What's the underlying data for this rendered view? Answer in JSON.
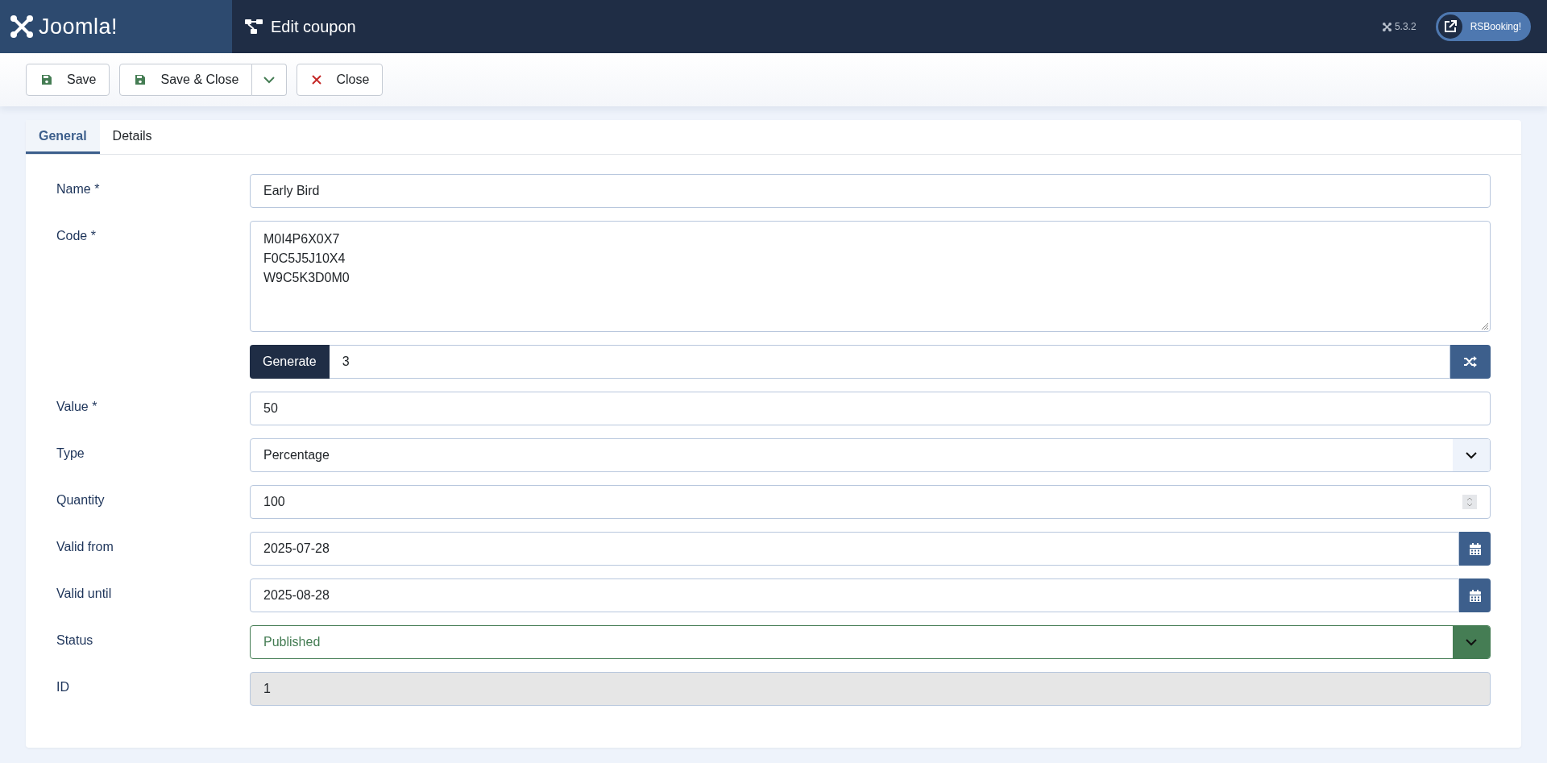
{
  "header": {
    "logo": "Joomla!",
    "title": "Edit coupon",
    "version": "5.3.2",
    "site_link": "RSBooking!"
  },
  "toolbar": {
    "buttons": [
      {
        "kind": "save",
        "label": "Save"
      },
      {
        "kind": "save-close",
        "label": "Save & Close"
      },
      {
        "kind": "close",
        "label": "Close"
      }
    ]
  },
  "tabs": [
    {
      "label": "General",
      "selected": true
    },
    {
      "label": "Details",
      "selected": false
    }
  ],
  "fields": [
    {
      "kind": "text",
      "label": "Name *",
      "value": "Early Bird"
    },
    {
      "kind": "codes",
      "label": "Code *",
      "value": "M0I4P6X0X7\nF0C5J5J10X4\nW9C5K3D0M0",
      "generate_label": "Generate",
      "generate_count": "3"
    },
    {
      "kind": "text",
      "label": "Value *",
      "value": "50"
    },
    {
      "kind": "select",
      "label": "Type",
      "value": "Percentage"
    },
    {
      "kind": "number",
      "label": "Quantity",
      "value": "100"
    },
    {
      "kind": "date",
      "label": "Valid from",
      "value": "2025-07-28"
    },
    {
      "kind": "date",
      "label": "Valid until",
      "value": "2025-08-28"
    },
    {
      "kind": "status",
      "label": "Status",
      "value": "Published"
    },
    {
      "kind": "readonly",
      "label": "ID",
      "value": "1"
    }
  ]
}
